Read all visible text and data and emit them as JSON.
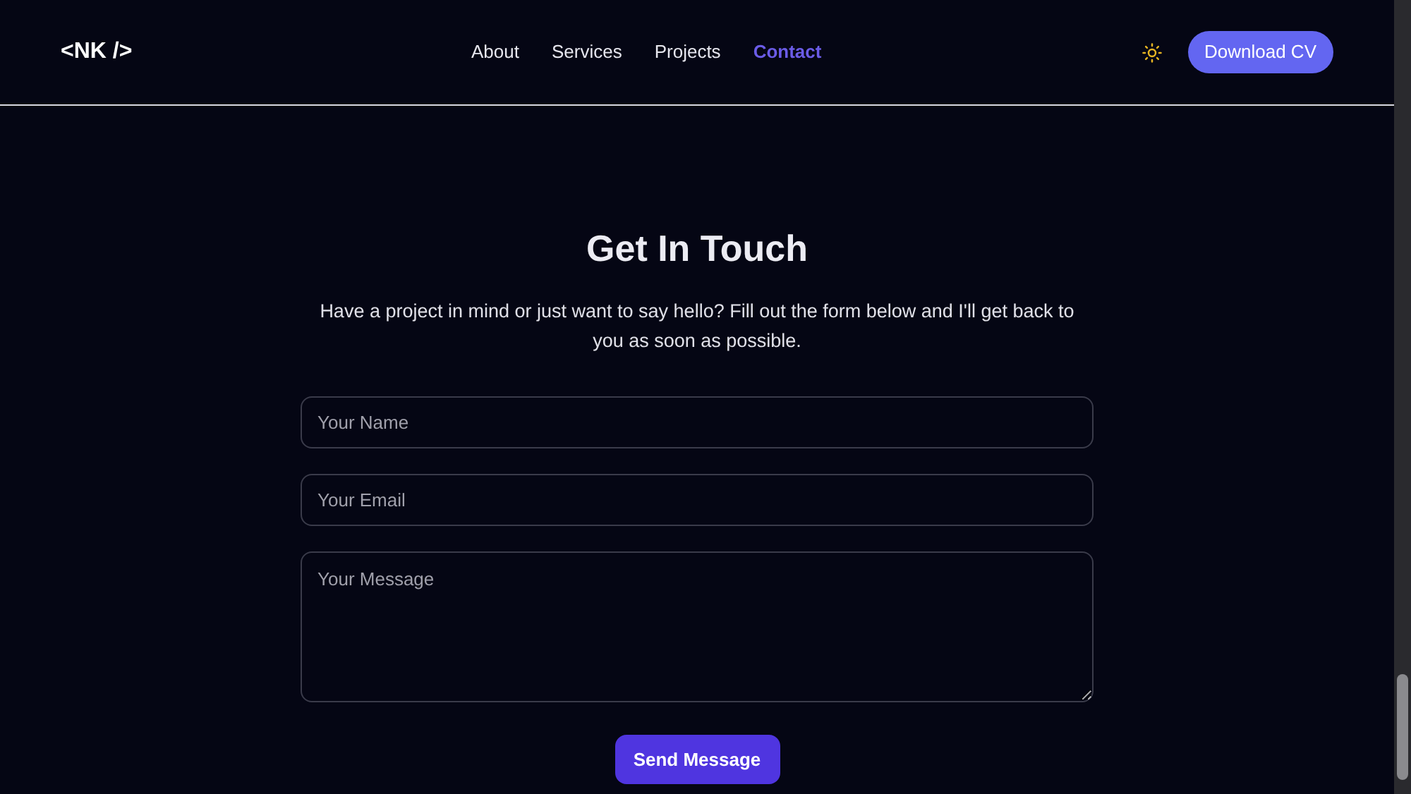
{
  "nav": {
    "logo": "<NK />",
    "links": [
      {
        "label": "About",
        "selected": false
      },
      {
        "label": "Services",
        "selected": false
      },
      {
        "label": "Projects",
        "selected": false
      },
      {
        "label": "Contact",
        "selected": true
      }
    ],
    "cta": "Download CV"
  },
  "contact": {
    "title": "Get In Touch",
    "intro": "Have a project in mind or just want to say hello? Fill out the form below and I'll get back to you as soon as possible.",
    "fields": [
      {
        "kind": "input",
        "placeholder": "Your Name"
      },
      {
        "kind": "input",
        "placeholder": "Your Email"
      },
      {
        "kind": "textarea",
        "placeholder": "Your Message"
      }
    ],
    "submit": "Send Message"
  }
}
